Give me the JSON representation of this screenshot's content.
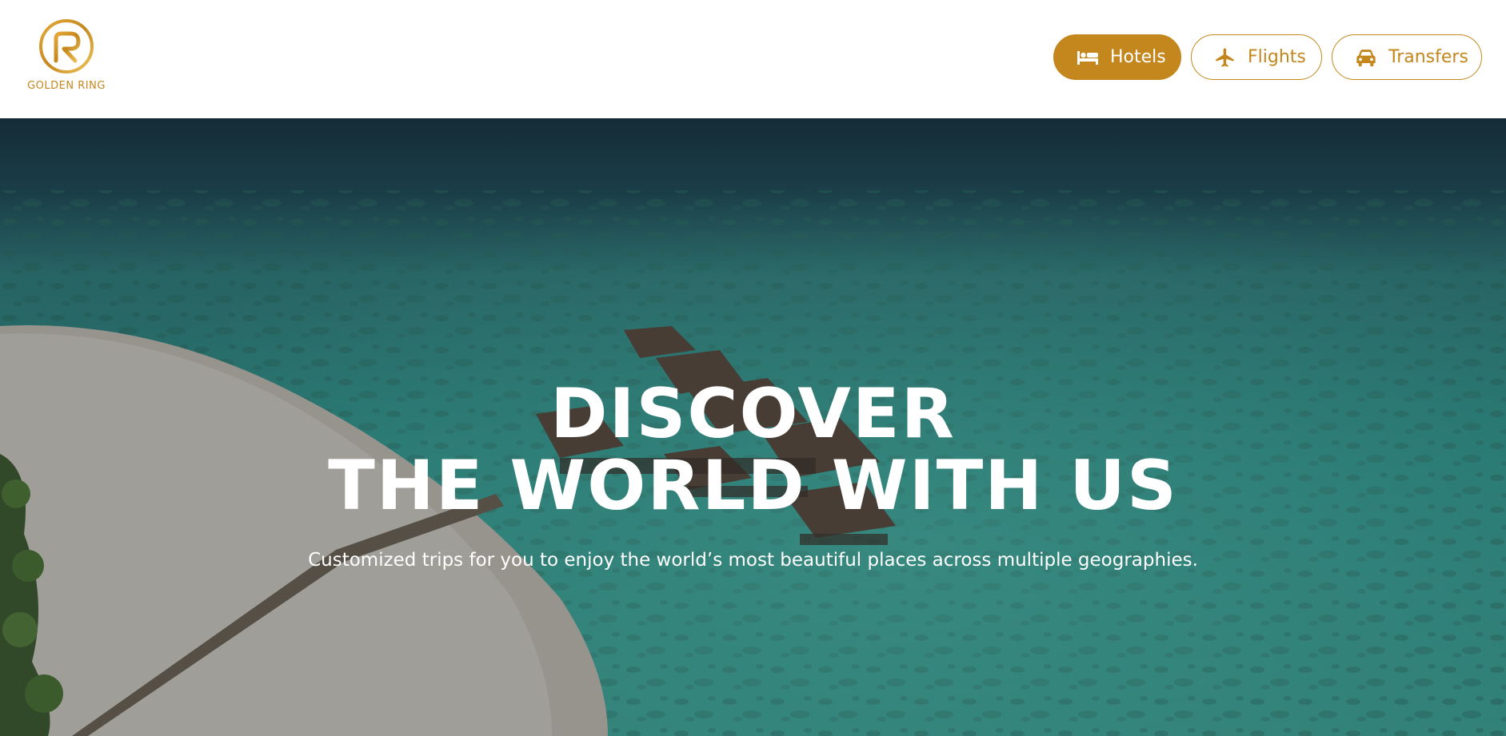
{
  "brand": {
    "name": "GOLDEN RING",
    "accent_color": "#c4871e",
    "logo_icon": "golden-ring-logo"
  },
  "nav": {
    "items": [
      {
        "label": "Hotels",
        "icon": "bed-icon",
        "active": true
      },
      {
        "label": "Flights",
        "icon": "airplane-icon",
        "active": false
      },
      {
        "label": "Transfers",
        "icon": "car-icon",
        "active": false
      }
    ]
  },
  "hero": {
    "title_line1": "DISCOVER",
    "title_line2": "THE WORLD WITH US",
    "subtitle": "Customized trips for you to enjoy the world’s most beautiful places across multiple geographies."
  }
}
